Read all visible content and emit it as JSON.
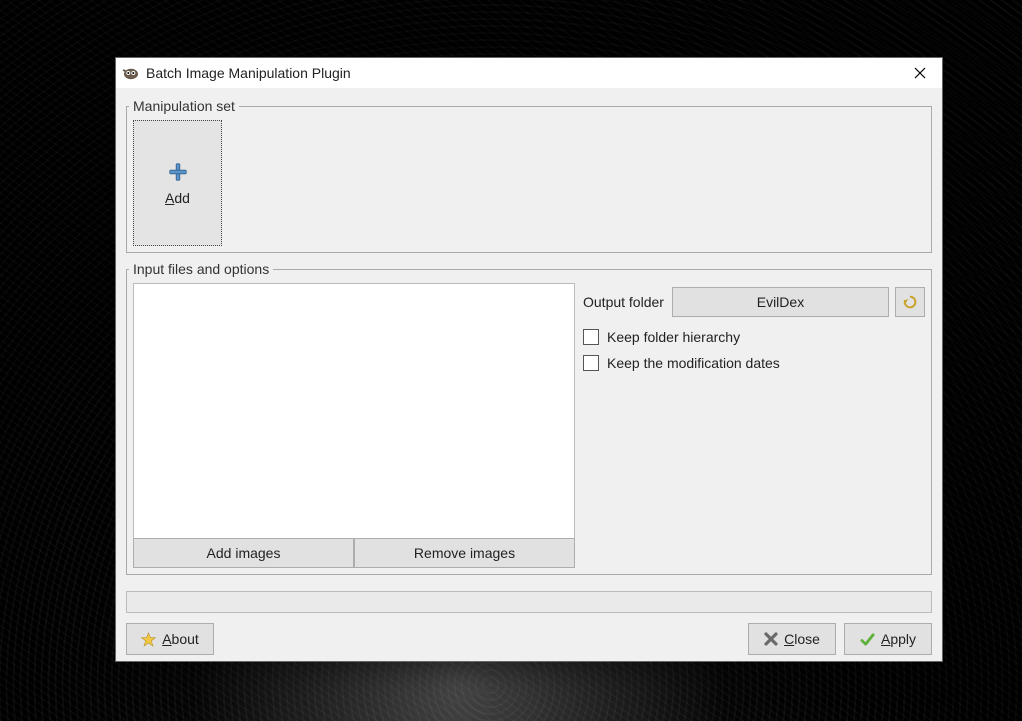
{
  "window": {
    "title": "Batch Image Manipulation Plugin"
  },
  "manipulation": {
    "legend": "Manipulation set",
    "add_prefix": "A",
    "add_suffix": "dd"
  },
  "input": {
    "legend": "Input files and options",
    "add_images": "Add images",
    "remove_images": "Remove images",
    "output_label": "Output folder",
    "output_value": "EvilDex",
    "checkbox1": "Keep folder hierarchy",
    "checkbox2": "Keep the modification dates"
  },
  "footer": {
    "about_prefix": "A",
    "about_suffix": "bout",
    "close_prefix": "C",
    "close_suffix": "lose",
    "apply_prefix": "A",
    "apply_suffix": "pply"
  }
}
